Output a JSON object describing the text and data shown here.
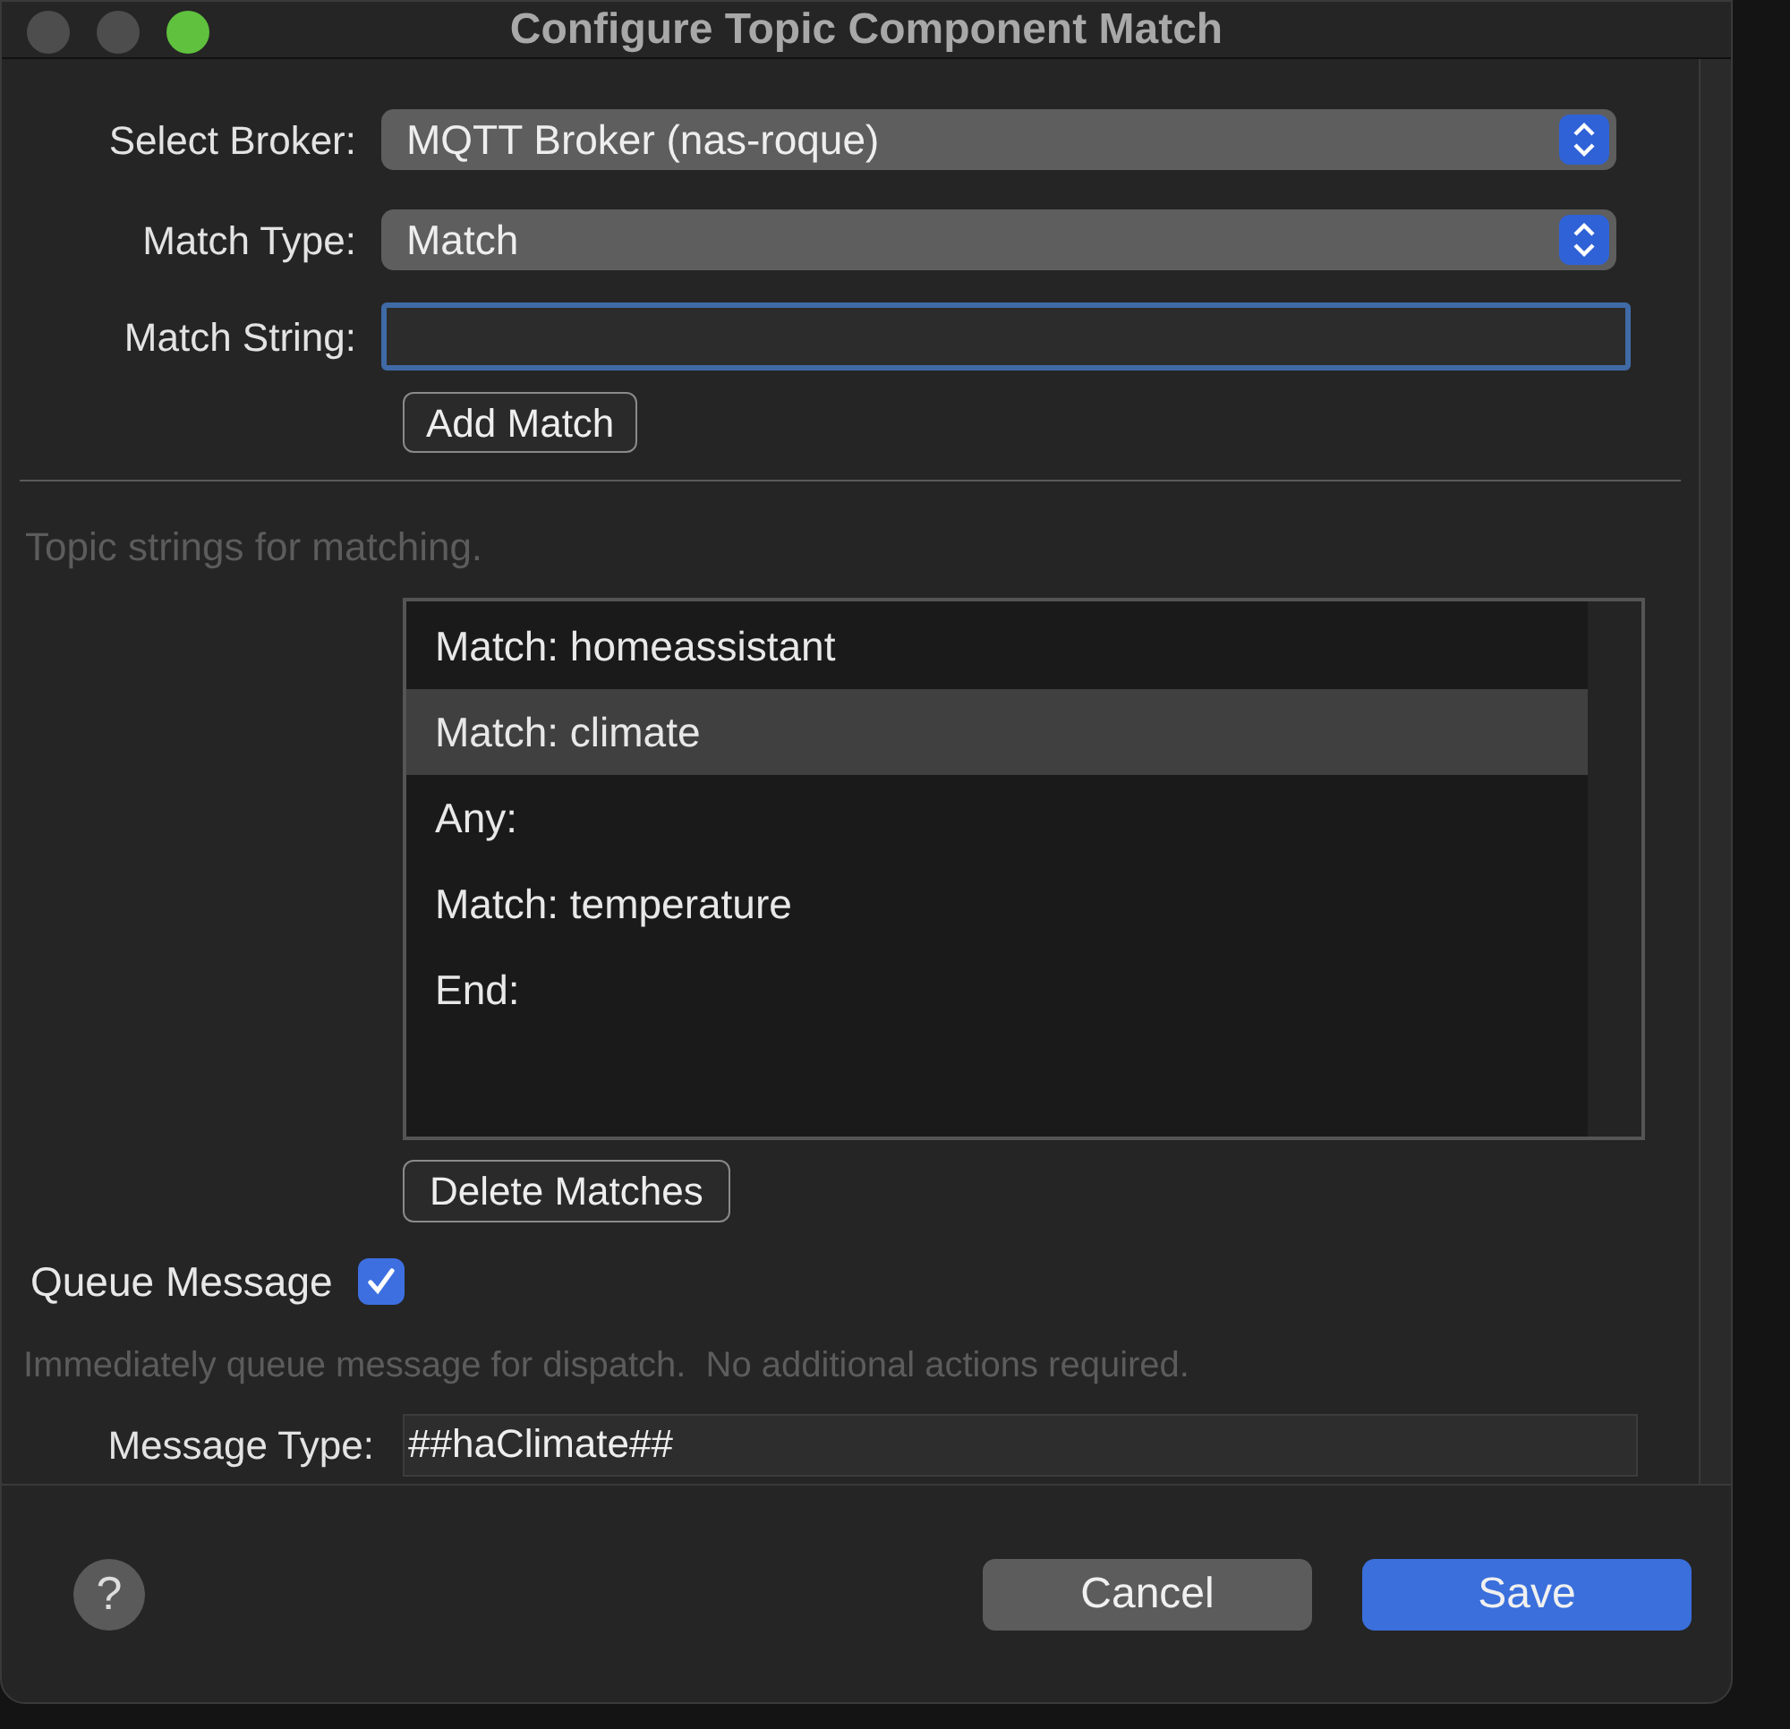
{
  "window": {
    "title": "Configure Topic Component Match"
  },
  "broker": {
    "label": "Select Broker:",
    "value": "MQTT Broker (nas-roque)"
  },
  "match_type": {
    "label": "Match Type:",
    "value": "Match"
  },
  "match_string": {
    "label": "Match String:"
  },
  "add_button": "Add Match",
  "topic_hint": "Topic strings for matching.",
  "matches": [
    {
      "text": "Match: homeassistant",
      "selected": false
    },
    {
      "text": "Match: climate",
      "selected": true
    },
    {
      "text": "Any:",
      "selected": false
    },
    {
      "text": "Match: temperature",
      "selected": false
    },
    {
      "text": "End:",
      "selected": false
    }
  ],
  "delete_button": "Delete Matches",
  "queue": {
    "label": "Queue Message",
    "checked": true
  },
  "queue_hint": "Immediately queue message for dispatch.  No additional actions required.",
  "message_type": {
    "label": "Message Type:",
    "value": "##haClimate##"
  },
  "help": "?",
  "buttons": [
    {
      "label": "Cancel",
      "kind": "secondary"
    },
    {
      "label": "Save",
      "kind": "primary"
    }
  ]
}
